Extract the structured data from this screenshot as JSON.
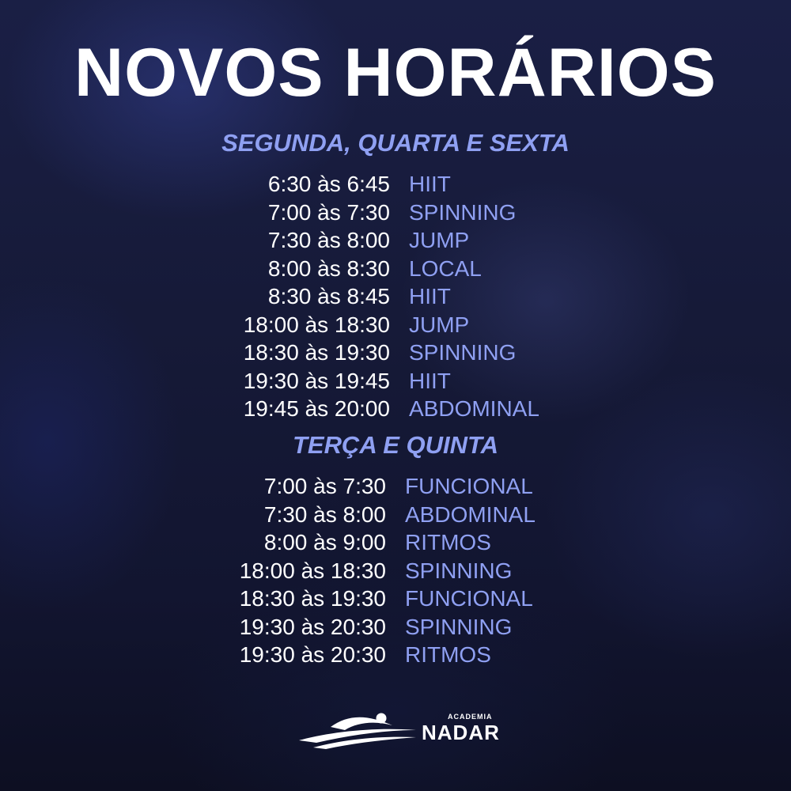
{
  "title": "NOVOS HORÁRIOS",
  "sections": [
    {
      "heading": "SEGUNDA, QUARTA E SEXTA",
      "rows": [
        {
          "time": "6:30 às 6:45",
          "class": "HIIT"
        },
        {
          "time": "7:00 às 7:30",
          "class": "SPINNING"
        },
        {
          "time": "7:30 às 8:00",
          "class": "JUMP"
        },
        {
          "time": "8:00 às 8:30",
          "class": "LOCAL"
        },
        {
          "time": "8:30 às 8:45",
          "class": "HIIT"
        },
        {
          "time": "18:00 às 18:30",
          "class": "JUMP"
        },
        {
          "time": "18:30 às 19:30",
          "class": "SPINNING"
        },
        {
          "time": "19:30 às 19:45",
          "class": "HIIT"
        },
        {
          "time": "19:45 às 20:00",
          "class": "ABDOMINAL"
        }
      ]
    },
    {
      "heading": "TERÇA E QUINTA",
      "rows": [
        {
          "time": "7:00 às 7:30",
          "class": "FUNCIONAL"
        },
        {
          "time": "7:30 às 8:00",
          "class": "ABDOMINAL"
        },
        {
          "time": "8:00 às 9:00",
          "class": "RITMOS"
        },
        {
          "time": "18:00 às 18:30",
          "class": "SPINNING"
        },
        {
          "time": "18:30 às 19:30",
          "class": "FUNCIONAL"
        },
        {
          "time": "19:30 às 20:30",
          "class": "SPINNING"
        },
        {
          "time": "19:30 às 20:30",
          "class": "RITMOS"
        }
      ]
    }
  ],
  "logo": {
    "small_text": "ACADEMIA",
    "brand_text": "NADAR",
    "icon": "swimmer-waves-icon"
  },
  "colors": {
    "accent": "#8fa0f2",
    "text": "#ffffff",
    "background": "#141833"
  }
}
